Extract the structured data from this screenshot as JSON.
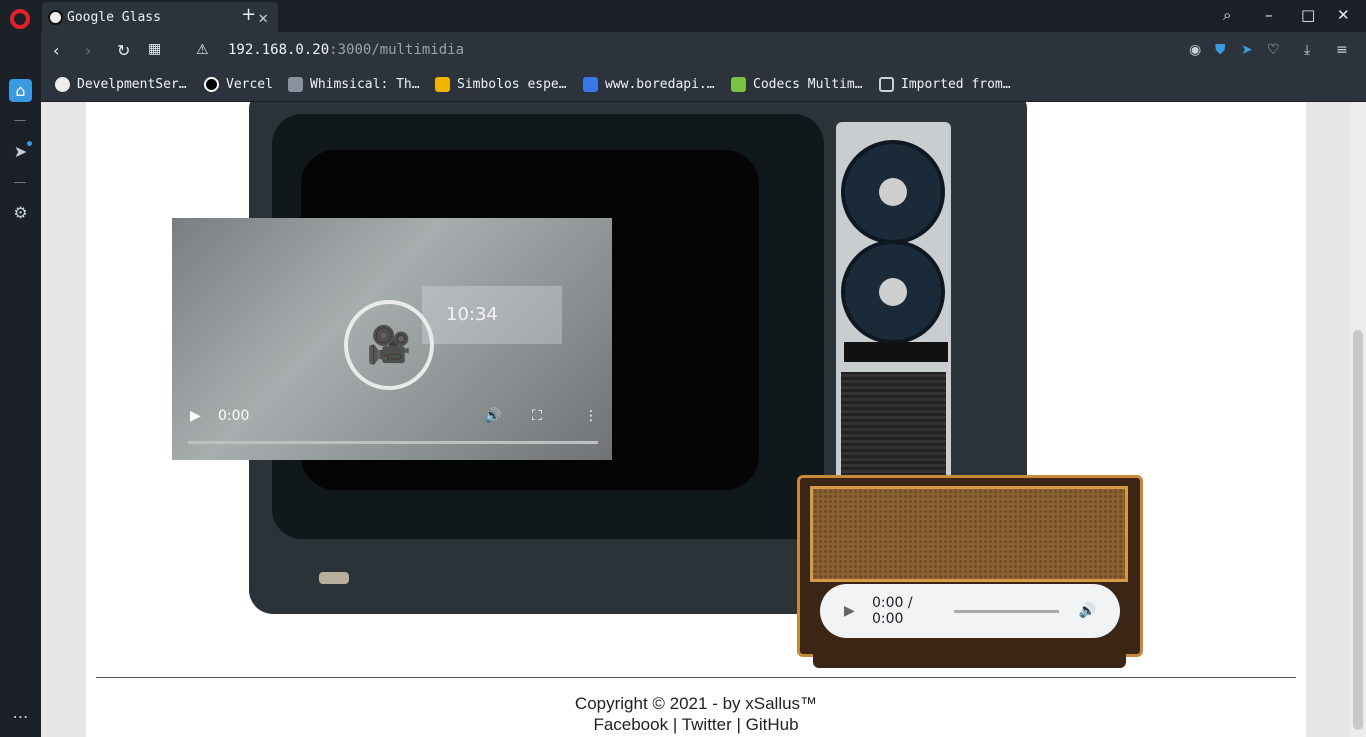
{
  "browser": {
    "tab_title": "Google Glass",
    "url_host": "192.168.0.20",
    "url_rest": ":3000/multimidia",
    "bookmarks": [
      "DevelpmentSer…",
      "Vercel",
      "Whimsical: Th…",
      "Simbolos espe…",
      "www.boredapi.…",
      "Codecs Multim…",
      "Imported from…"
    ]
  },
  "video": {
    "current_time": "0:00",
    "clock": "10:34"
  },
  "audio": {
    "time": "0:00 / 0:00"
  },
  "footer": {
    "copyright": "Copyright © 2021 - by xSallus™",
    "links": [
      "Facebook",
      "Twitter",
      "GitHub"
    ],
    "separator": "|"
  },
  "colors": {
    "accent": "#3a99e0",
    "opera_red": "#e3202c"
  }
}
